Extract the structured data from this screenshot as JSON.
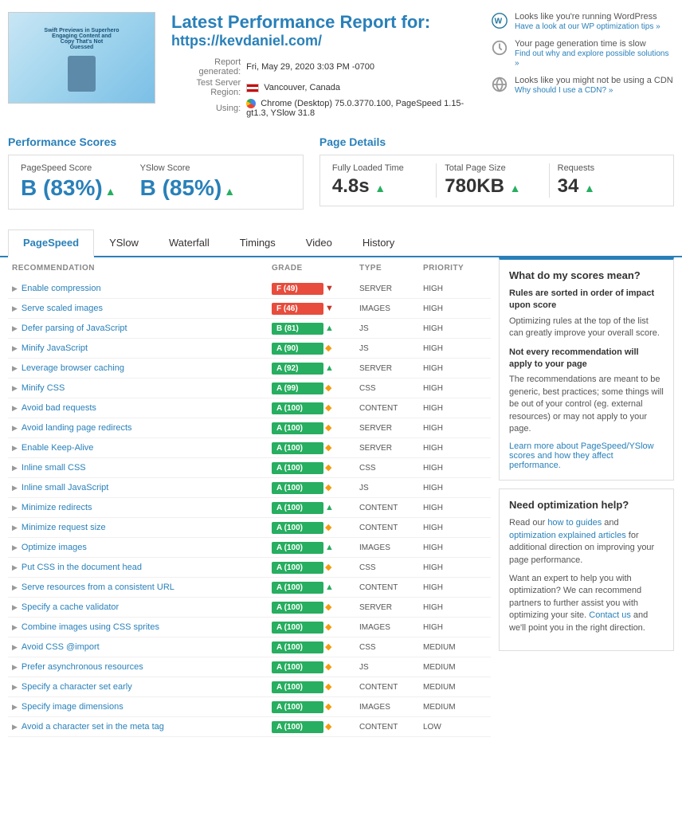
{
  "header": {
    "title": "Latest Performance Report for:",
    "url": "https://kevdaniel.com/",
    "report_generated_label": "Report generated:",
    "report_generated_value": "Fri, May 29, 2020 3:03 PM -0700",
    "test_server_label": "Test Server Region:",
    "test_server_value": "Vancouver, Canada",
    "using_label": "Using:",
    "using_value": "Chrome (Desktop) 75.0.3770.100, PageSpeed 1.15-gt1.3, YSlow 31.8",
    "tips": [
      {
        "icon": "wordpress-icon",
        "title": "Looks like you're running WordPress",
        "link_text": "Have a look at our WP optimization tips »",
        "link_href": "#"
      },
      {
        "icon": "clock-icon",
        "title": "Your page generation time is slow",
        "link_text": "Find out why and explore possible solutions »",
        "link_href": "#"
      },
      {
        "icon": "globe-icon",
        "title": "Looks like you might not be using a CDN",
        "link_text": "Why should I use a CDN? »",
        "link_href": "#"
      }
    ],
    "thumbnail_lines": [
      "Swift Previews in Superhero",
      "Engaging Content and",
      "Copy That's Not",
      "Guessed"
    ]
  },
  "performance_scores": {
    "title": "Performance Scores",
    "pagespeed_label": "PageSpeed Score",
    "pagespeed_value": "B (83%)",
    "pagespeed_grade": "B",
    "pagespeed_pct": "(83%)",
    "yslow_label": "YSlow Score",
    "yslow_value": "B (85%)",
    "yslow_grade": "B",
    "yslow_pct": "(85%)"
  },
  "page_details": {
    "title": "Page Details",
    "items": [
      {
        "label": "Fully Loaded Time",
        "value": "4.8s",
        "arrow": "↑"
      },
      {
        "label": "Total Page Size",
        "value": "780KB",
        "arrow": "↑"
      },
      {
        "label": "Requests",
        "value": "34",
        "arrow": "↑"
      }
    ]
  },
  "tabs": [
    {
      "id": "pagespeed",
      "label": "PageSpeed",
      "active": true
    },
    {
      "id": "yslow",
      "label": "YSlow",
      "active": false
    },
    {
      "id": "waterfall",
      "label": "Waterfall",
      "active": false
    },
    {
      "id": "timings",
      "label": "Timings",
      "active": false
    },
    {
      "id": "video",
      "label": "Video",
      "active": false
    },
    {
      "id": "history",
      "label": "History",
      "active": false
    }
  ],
  "table": {
    "headers": [
      "RECOMMENDATION",
      "GRADE",
      "TYPE",
      "PRIORITY"
    ],
    "rows": [
      {
        "name": "Enable compression",
        "grade": "F (49)",
        "grade_class": "red",
        "arrow": "down",
        "type": "SERVER",
        "priority": "HIGH"
      },
      {
        "name": "Serve scaled images",
        "grade": "F (46)",
        "grade_class": "red",
        "arrow": "down",
        "type": "IMAGES",
        "priority": "HIGH"
      },
      {
        "name": "Defer parsing of JavaScript",
        "grade": "B (81)",
        "grade_class": "green",
        "arrow": "up",
        "type": "JS",
        "priority": "HIGH"
      },
      {
        "name": "Minify JavaScript",
        "grade": "A (90)",
        "grade_class": "green",
        "arrow": "diamond",
        "type": "JS",
        "priority": "HIGH"
      },
      {
        "name": "Leverage browser caching",
        "grade": "A (92)",
        "grade_class": "green",
        "arrow": "up",
        "type": "SERVER",
        "priority": "HIGH"
      },
      {
        "name": "Minify CSS",
        "grade": "A (99)",
        "grade_class": "green",
        "arrow": "diamond",
        "type": "CSS",
        "priority": "HIGH"
      },
      {
        "name": "Avoid bad requests",
        "grade": "A (100)",
        "grade_class": "green",
        "arrow": "diamond",
        "type": "CONTENT",
        "priority": "HIGH"
      },
      {
        "name": "Avoid landing page redirects",
        "grade": "A (100)",
        "grade_class": "green",
        "arrow": "diamond",
        "type": "SERVER",
        "priority": "HIGH"
      },
      {
        "name": "Enable Keep-Alive",
        "grade": "A (100)",
        "grade_class": "green",
        "arrow": "diamond",
        "type": "SERVER",
        "priority": "HIGH"
      },
      {
        "name": "Inline small CSS",
        "grade": "A (100)",
        "grade_class": "green",
        "arrow": "diamond",
        "type": "CSS",
        "priority": "HIGH"
      },
      {
        "name": "Inline small JavaScript",
        "grade": "A (100)",
        "grade_class": "green",
        "arrow": "diamond",
        "type": "JS",
        "priority": "HIGH"
      },
      {
        "name": "Minimize redirects",
        "grade": "A (100)",
        "grade_class": "green",
        "arrow": "up",
        "type": "CONTENT",
        "priority": "HIGH"
      },
      {
        "name": "Minimize request size",
        "grade": "A (100)",
        "grade_class": "green",
        "arrow": "diamond",
        "type": "CONTENT",
        "priority": "HIGH"
      },
      {
        "name": "Optimize images",
        "grade": "A (100)",
        "grade_class": "green",
        "arrow": "up",
        "type": "IMAGES",
        "priority": "HIGH"
      },
      {
        "name": "Put CSS in the document head",
        "grade": "A (100)",
        "grade_class": "green",
        "arrow": "diamond",
        "type": "CSS",
        "priority": "HIGH"
      },
      {
        "name": "Serve resources from a consistent URL",
        "grade": "A (100)",
        "grade_class": "green",
        "arrow": "up",
        "type": "CONTENT",
        "priority": "HIGH"
      },
      {
        "name": "Specify a cache validator",
        "grade": "A (100)",
        "grade_class": "green",
        "arrow": "diamond",
        "type": "SERVER",
        "priority": "HIGH"
      },
      {
        "name": "Combine images using CSS sprites",
        "grade": "A (100)",
        "grade_class": "green",
        "arrow": "diamond",
        "type": "IMAGES",
        "priority": "HIGH"
      },
      {
        "name": "Avoid CSS @import",
        "grade": "A (100)",
        "grade_class": "green",
        "arrow": "diamond",
        "type": "CSS",
        "priority": "MEDIUM"
      },
      {
        "name": "Prefer asynchronous resources",
        "grade": "A (100)",
        "grade_class": "green",
        "arrow": "diamond",
        "type": "JS",
        "priority": "MEDIUM"
      },
      {
        "name": "Specify a character set early",
        "grade": "A (100)",
        "grade_class": "green",
        "arrow": "diamond",
        "type": "CONTENT",
        "priority": "MEDIUM"
      },
      {
        "name": "Specify image dimensions",
        "grade": "A (100)",
        "grade_class": "green",
        "arrow": "diamond",
        "type": "IMAGES",
        "priority": "MEDIUM"
      },
      {
        "name": "Avoid a character set in the meta tag",
        "grade": "A (100)",
        "grade_class": "green",
        "arrow": "diamond",
        "type": "CONTENT",
        "priority": "LOW"
      }
    ]
  },
  "sidebar": {
    "scores_box": {
      "title": "What do my scores mean?",
      "highlight": "Rules are sorted in order of impact upon score",
      "text1": "Optimizing rules at the top of the list can greatly improve your overall score.",
      "highlight2": "Not every recommendation will apply to your page",
      "text2": "The recommendations are meant to be generic, best practices; some things will be out of your control (eg. external resources) or may not apply to your page.",
      "link_text": "Learn more about PageSpeed/YSlow scores and how they affect performance.",
      "link_href": "#"
    },
    "optimization_box": {
      "title": "Need optimization help?",
      "text1_before": "Read our ",
      "link1_text": "how to guides",
      "text1_mid": " and ",
      "link2_text": "optimization explained articles",
      "text1_after": " for additional direction on improving your page performance.",
      "text2_before": "Want an expert to help you with optimization? We can recommend partners to further assist you with optimizing your site. ",
      "link3_text": "Contact us",
      "text2_after": " and we'll point you in the right direction."
    }
  }
}
